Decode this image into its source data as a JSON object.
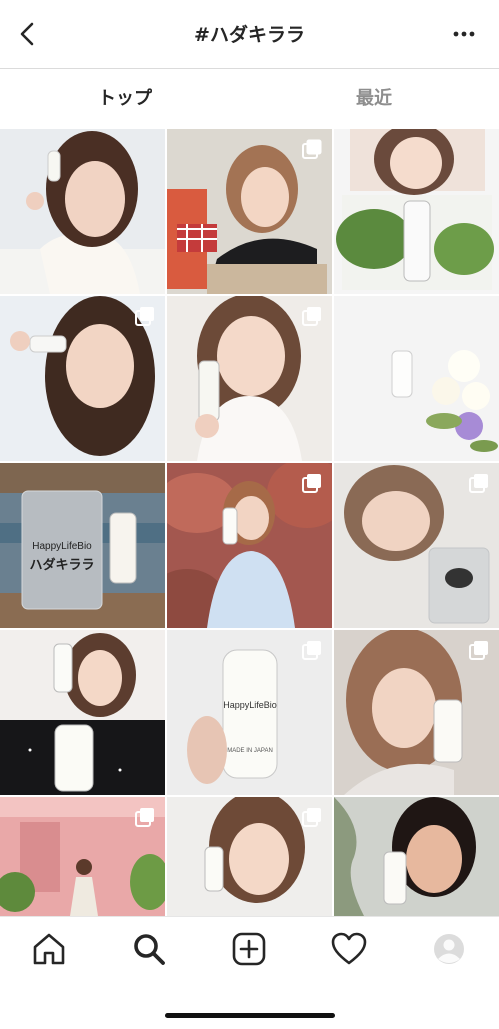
{
  "header": {
    "title": "#ハダキララ"
  },
  "icons": {
    "back": "chevron-left-icon",
    "more": "more-dots-icon"
  },
  "tabs": [
    {
      "label": "トップ",
      "active": true
    },
    {
      "label": "最近",
      "active": false
    }
  ],
  "product": {
    "brand": "HappyLifeBio",
    "name": "ハダキララ",
    "made_in": "MADE IN JAPAN"
  },
  "nav": [
    "home-icon",
    "search-icon",
    "add-post-icon",
    "heart-icon",
    "profile-avatar-icon"
  ]
}
